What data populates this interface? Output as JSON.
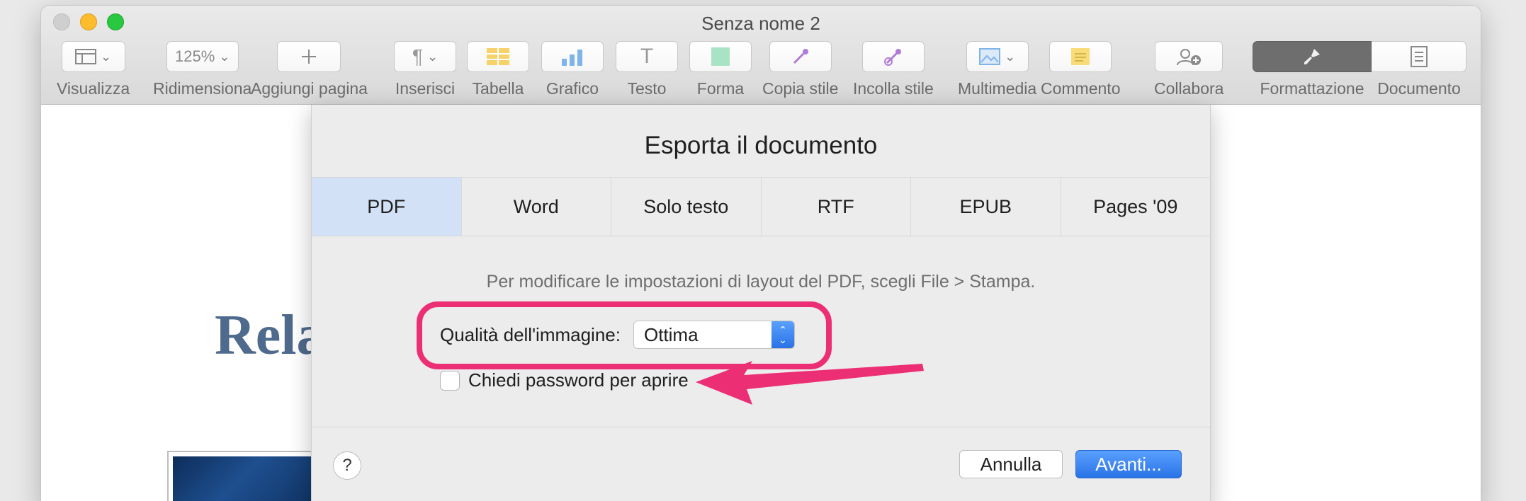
{
  "window": {
    "title": "Senza nome 2"
  },
  "toolbar": {
    "zoom_value": "125%",
    "labels": {
      "view": "Visualizza",
      "zoom": "Ridimensiona",
      "add_page": "Aggiungi pagina",
      "insert": "Inserisci",
      "table": "Tabella",
      "chart": "Grafico",
      "text": "Testo",
      "shape": "Forma",
      "copy_style": "Copia stile",
      "paste_style": "Incolla stile",
      "media": "Multimedia",
      "comment": "Commento",
      "collaborate": "Collabora",
      "format": "Formattazione",
      "document": "Documento"
    },
    "icons": {
      "view": "sidebar-icon",
      "add_page": "plus-icon",
      "insert": "pilcrow-icon",
      "table": "table-icon",
      "chart": "bar-chart-icon",
      "text": "text-icon",
      "shape": "shape-icon",
      "copy_style": "eyedropper-icon",
      "paste_style": "eyedropper-icon",
      "media": "image-icon",
      "comment": "note-icon",
      "collaborate": "collaborate-icon",
      "format": "paintbrush-icon",
      "document": "document-icon"
    }
  },
  "document": {
    "heading_fragment": "Rela"
  },
  "dialog": {
    "title": "Esporta il documento",
    "tabs": [
      {
        "label": "PDF",
        "active": true
      },
      {
        "label": "Word",
        "active": false
      },
      {
        "label": "Solo testo",
        "active": false
      },
      {
        "label": "RTF",
        "active": false
      },
      {
        "label": "EPUB",
        "active": false
      },
      {
        "label": "Pages '09",
        "active": false
      }
    ],
    "hint": "Per modificare le impostazioni di layout del PDF, scegli File > Stampa.",
    "image_quality": {
      "label": "Qualità dell'immagine:",
      "value": "Ottima"
    },
    "password": {
      "label": "Chiedi password per aprire",
      "checked": false
    },
    "help_label": "?",
    "cancel_label": "Annulla",
    "next_label": "Avanti..."
  },
  "colors": {
    "accent": "#2a73e6",
    "annotation": "#ec2f74",
    "active_tab": "#d2e1f5"
  }
}
